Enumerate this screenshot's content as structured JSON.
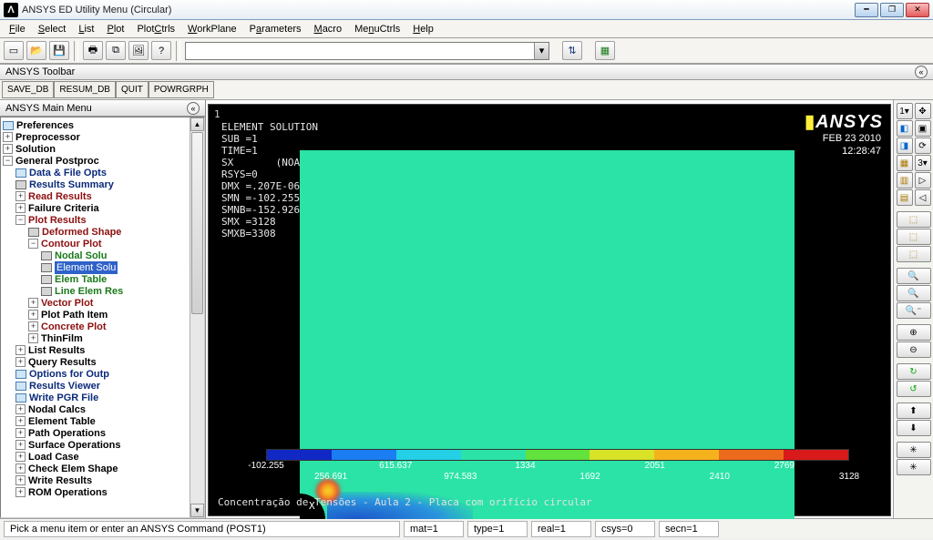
{
  "window": {
    "title": "ANSYS ED Utility Menu (Circular)"
  },
  "menu": [
    "File",
    "Select",
    "List",
    "Plot",
    "PlotCtrls",
    "WorkPlane",
    "Parameters",
    "Macro",
    "MenuCtrls",
    "Help"
  ],
  "combo": {
    "value": ""
  },
  "ansys_toolbar_label": "ANSYS Toolbar",
  "ansys_toolbar": [
    "SAVE_DB",
    "RESUM_DB",
    "QUIT",
    "POWRGRPH"
  ],
  "main_menu_label": "ANSYS Main Menu",
  "tree": {
    "preferences": "Preferences",
    "preprocessor": "Preprocessor",
    "solution": "Solution",
    "general_postproc": "General Postproc",
    "data_file": "Data & File Opts",
    "results_summary": "Results Summary",
    "read_results": "Read Results",
    "failure_criteria": "Failure Criteria",
    "plot_results": "Plot Results",
    "deformed_shape": "Deformed Shape",
    "contour_plot": "Contour Plot",
    "nodal_solu": "Nodal Solu",
    "element_solu": "Element Solu",
    "elem_table": "Elem Table",
    "line_elem_res": "Line Elem Res",
    "vector_plot": "Vector Plot",
    "plot_path": "Plot Path Item",
    "concrete_plot": "Concrete Plot",
    "thinfilm": "ThinFilm",
    "list_results": "List Results",
    "query_results": "Query Results",
    "options_outp": "Options for Outp",
    "results_viewer": "Results Viewer",
    "write_pgr": "Write PGR File",
    "nodal_calcs": "Nodal Calcs",
    "element_table": "Element Table",
    "path_ops": "Path Operations",
    "surface_ops": "Surface Operations",
    "load_case": "Load Case",
    "check_elem": "Check Elem Shape",
    "write_results": "Write Results",
    "rom_ops": "ROM Operations"
  },
  "gfx": {
    "index": "1",
    "brand": "ANSYS",
    "date": "FEB 23 2010",
    "time": "12:28:47",
    "meta": "ELEMENT SOLUTION\nSUB =1\nTIME=1\nSX       (NOAVG)\nRSYS=0\nDMX =.207E-06\nSMN =-102.255\nSMNB=-152.926\nSMX =3128\nSMXB=3308",
    "axis_label": "X",
    "caption": "Concentração de Tensões - Aula 2 - Placa com orifício circular"
  },
  "legend": {
    "colors": [
      "#1028c4",
      "#1a7df2",
      "#23d0e6",
      "#2be3a6",
      "#62e23c",
      "#d8e227",
      "#f5b21c",
      "#ec6a1b",
      "#d81a1a"
    ],
    "ticks_top": [
      "-102.255",
      "615.637",
      "1334",
      "2051",
      "2769"
    ],
    "ticks_bot": [
      "256.691",
      "974.583",
      "1692",
      "2410",
      "3128"
    ]
  },
  "status": {
    "prompt": "Pick a menu item or enter an ANSYS Command (POST1)",
    "mat": "mat=1",
    "type": "type=1",
    "real": "real=1",
    "csys": "csys=0",
    "secn": "secn=1"
  }
}
